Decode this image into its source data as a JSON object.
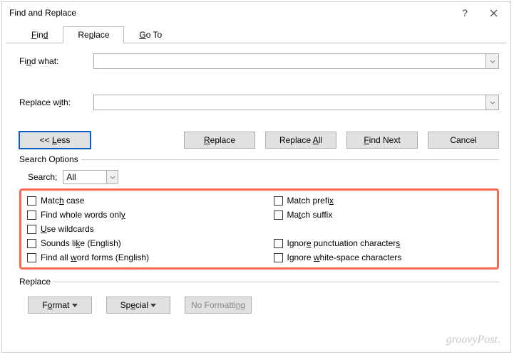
{
  "title": "Find and Replace",
  "tabs": {
    "find": "Find",
    "replace": "Replace",
    "goto": "Go To"
  },
  "labels": {
    "find_what": "Find what:",
    "replace_with": "Replace with:",
    "search": "Search",
    "search_options": "Search Options",
    "replace_section": "Replace"
  },
  "buttons": {
    "less": "<< Less",
    "replace": "Replace",
    "replace_all": "Replace All",
    "find_next": "Find Next",
    "cancel": "Cancel",
    "format": "Format",
    "special": "Special",
    "no_formatting": "No Formatting"
  },
  "search_scope": "All",
  "checks": {
    "match_case": "Match case",
    "whole_words": "Find whole words only",
    "wildcards": "Use wildcards",
    "sounds": "Sounds like (English)",
    "word_forms": "Find all word forms (English)",
    "prefix": "Match prefix",
    "suffix": "Match suffix",
    "punct": "Ignore punctuation characters",
    "whitespace": "Ignore white-space characters"
  },
  "watermark": "groovyPost."
}
